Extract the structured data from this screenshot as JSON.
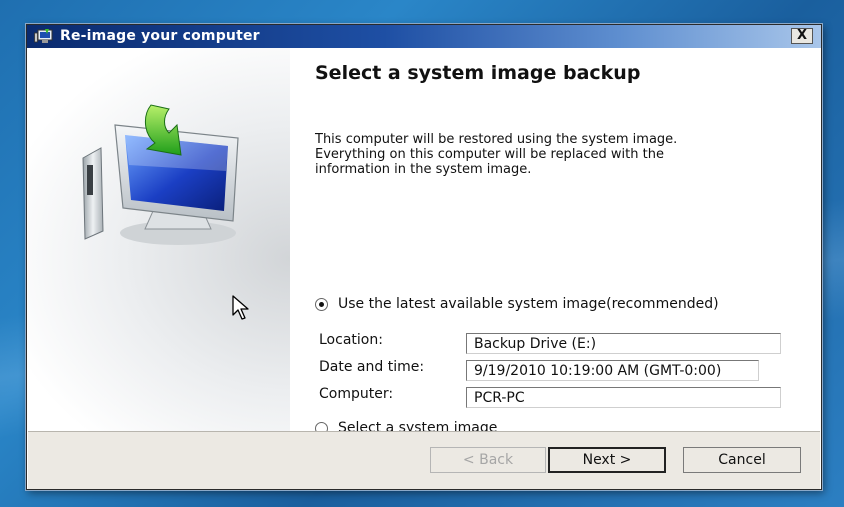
{
  "window": {
    "title": "Re-image your computer",
    "close_label": "X"
  },
  "main": {
    "heading": "Select a system image backup",
    "description_lines": [
      "This computer will be restored using the system image.",
      "Everything on this computer will be replaced with the",
      "information in the system image."
    ],
    "option_latest": {
      "label": "Use the latest available system image(recommended)",
      "selected": true
    },
    "fields": [
      {
        "label": "Location:",
        "value": "Backup Drive (E:)"
      },
      {
        "label": "Date and time:",
        "value": "9/19/2010 10:19:00 AM (GMT-0:00)"
      },
      {
        "label": "Computer:",
        "value": "PCR-PC"
      }
    ],
    "option_select": {
      "label": "Select a system image",
      "selected": false
    }
  },
  "footer": {
    "back_label": "< Back",
    "next_label": "Next >",
    "cancel_label": "Cancel"
  },
  "colors": {
    "titlebar_start": "#0a2a6e",
    "titlebar_end": "#a9c6ea",
    "desktop": "#1f6fb0",
    "dialog_footer": "#ece9e3"
  }
}
